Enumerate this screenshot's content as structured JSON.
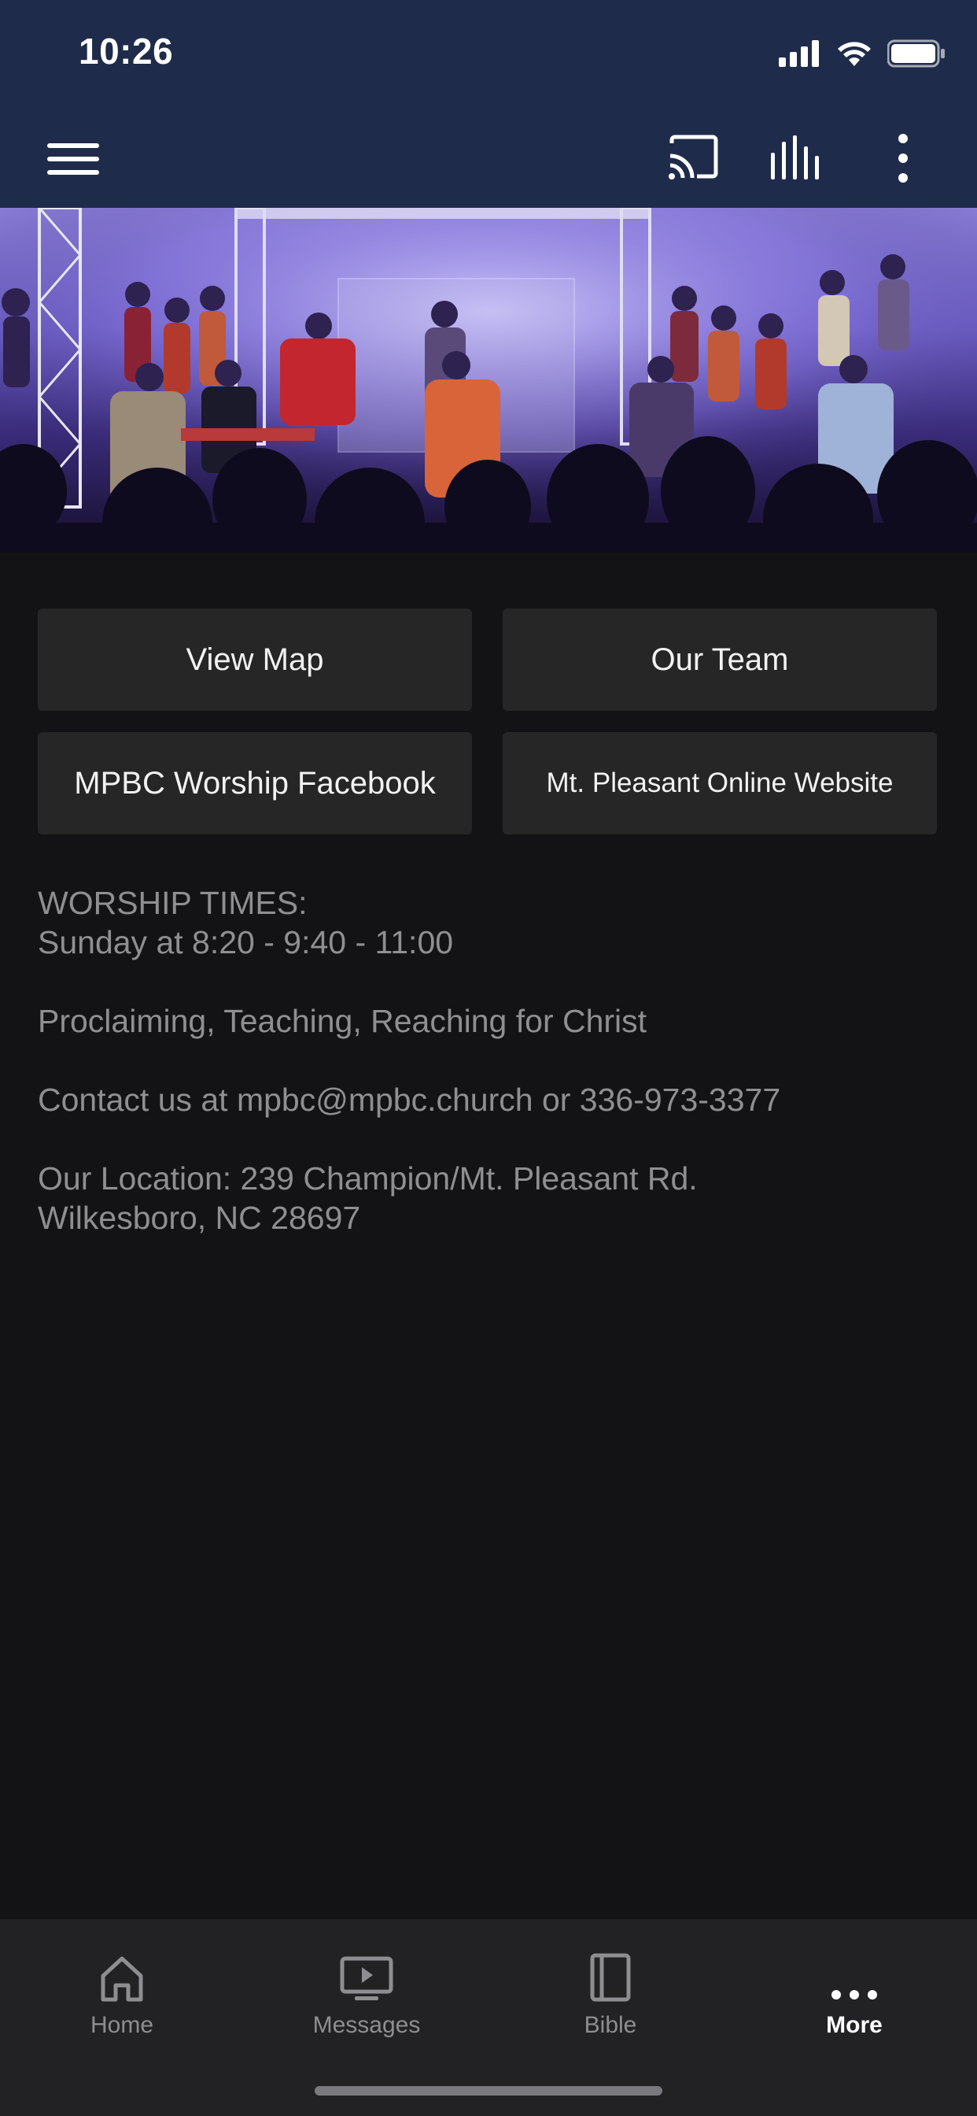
{
  "status_bar": {
    "time": "10:26"
  },
  "buttons": {
    "view_map": "View Map",
    "our_team": "Our Team",
    "facebook": "MPBC Worship Facebook",
    "website": "Mt. Pleasant Online Website"
  },
  "info": {
    "worship_heading": "WORSHIP TIMES:",
    "worship_times": "Sunday at 8:20 - 9:40 - 11:00",
    "tagline": "Proclaiming, Teaching, Reaching for Christ",
    "contact": "Contact us at mpbc@mpbc.church or 336-973-3377",
    "location_line1": "Our Location: 239 Champion/Mt. Pleasant Rd.",
    "location_line2": "Wilkesboro, NC 28697"
  },
  "tabs": {
    "home": "Home",
    "messages": "Messages",
    "bible": "Bible",
    "more": "More"
  },
  "icons": {
    "menu": "hamburger-menu-icon",
    "cast": "cast-icon",
    "audio": "audio-bars-icon",
    "more_vert": "vertical-dots-icon"
  },
  "colors": {
    "header": "#1f2b4a",
    "background": "#131315",
    "button": "#262627",
    "muted_text": "#8f8f93",
    "tab_bar": "#222224"
  }
}
